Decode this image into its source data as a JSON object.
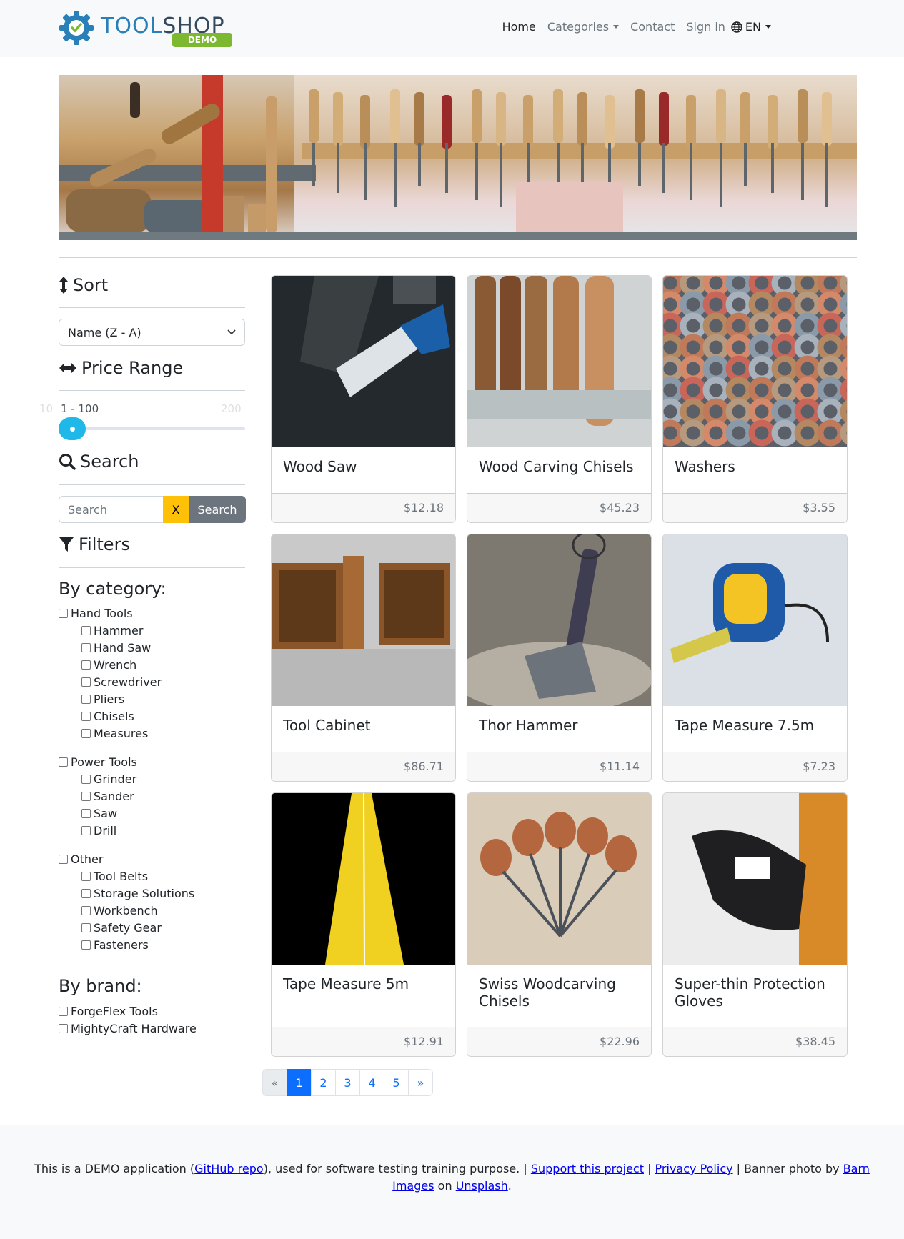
{
  "brand": {
    "name_part1": "TOOL",
    "name_part2": "SHOP",
    "badge": "DEMO"
  },
  "nav": {
    "home": "Home",
    "categories": "Categories",
    "contact": "Contact",
    "sign_in": "Sign in",
    "language": "EN"
  },
  "sidebar": {
    "sort_title": "Sort",
    "sort_selected": "Name (Z - A)",
    "price_title": "Price Range",
    "price_range_text": "1 - 100",
    "price_min_label": "10",
    "price_max_label": "200",
    "price_min": 1,
    "price_max": 100,
    "search_title": "Search",
    "search_placeholder": "Search",
    "clear_label": "X",
    "search_button": "Search",
    "filters_title": "Filters",
    "by_category": "By category:",
    "categories": [
      {
        "label": "Hand Tools",
        "children": [
          "Hammer",
          "Hand Saw",
          "Wrench",
          "Screwdriver",
          "Pliers",
          "Chisels",
          "Measures"
        ]
      },
      {
        "label": "Power Tools",
        "children": [
          "Grinder",
          "Sander",
          "Saw",
          "Drill"
        ]
      },
      {
        "label": "Other",
        "children": [
          "Tool Belts",
          "Storage Solutions",
          "Workbench",
          "Safety Gear",
          "Fasteners"
        ]
      }
    ],
    "by_brand": "By brand:",
    "brands": [
      "ForgeFlex Tools",
      "MightyCraft Hardware"
    ]
  },
  "products": [
    {
      "name": "Wood Saw",
      "price": "$12.18"
    },
    {
      "name": "Wood Carving Chisels",
      "price": "$45.23"
    },
    {
      "name": "Washers",
      "price": "$3.55"
    },
    {
      "name": "Tool Cabinet",
      "price": "$86.71"
    },
    {
      "name": "Thor Hammer",
      "price": "$11.14"
    },
    {
      "name": "Tape Measure 7.5m",
      "price": "$7.23"
    },
    {
      "name": "Tape Measure 5m",
      "price": "$12.91"
    },
    {
      "name": "Swiss Woodcarving Chisels",
      "price": "$22.96"
    },
    {
      "name": "Super-thin Protection Gloves",
      "price": "$38.45"
    }
  ],
  "pagination": {
    "prev": "«",
    "pages": [
      "1",
      "2",
      "3",
      "4",
      "5"
    ],
    "active": "1",
    "next": "»"
  },
  "footer": {
    "t1": "This is a DEMO application (",
    "github": "GitHub repo",
    "t2": "), used for software testing training purpose. | ",
    "support": "Support this project",
    "t3": " | ",
    "privacy": "Privacy Policy",
    "t4": " | Banner photo by ",
    "barn": "Barn Images",
    "t5": " on ",
    "unsplash": "Unsplash",
    "t6": "."
  },
  "colors": {
    "accent": "#0d6efd",
    "slider": "#1fb8e8",
    "clear_btn": "#ffc107",
    "search_btn": "#6c757d",
    "logo_blue": "#2980b9",
    "logo_badge": "#7cb830"
  }
}
